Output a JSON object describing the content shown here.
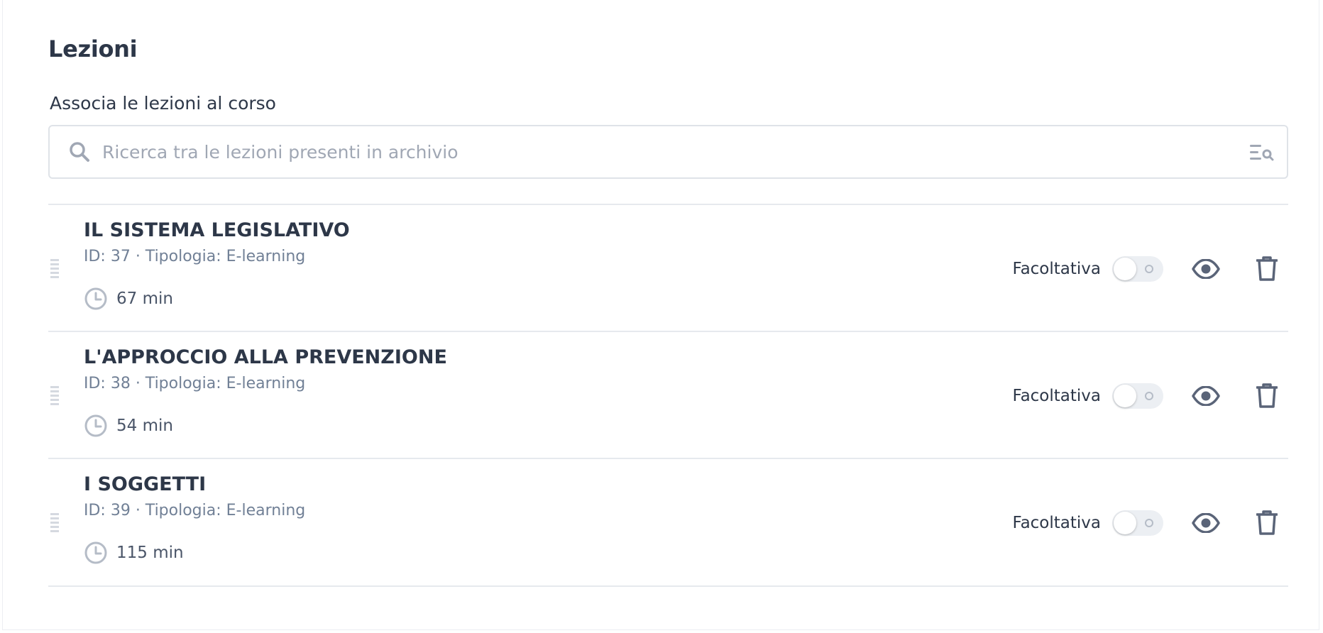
{
  "section": {
    "title": "Lezioni",
    "field_label": "Associa le lezioni al corso",
    "search_placeholder": "Ricerca tra le lezioni presenti in archivio"
  },
  "icons": {
    "search": "search-icon",
    "filter": "filter-search-icon",
    "drag": "drag-handle-icon",
    "clock": "clock-icon",
    "view": "eye-icon",
    "delete": "trash-icon"
  },
  "colors": {
    "text_primary": "#2d3748",
    "text_secondary": "#718096",
    "icon": "#5a6478",
    "toggle_off": "#eceff3",
    "divider": "#e6e9ee"
  },
  "lessons": [
    {
      "title": "IL SISTEMA LEGISLATIVO",
      "meta": "ID: 37 · Tipologia: E-learning",
      "duration": "67 min",
      "optional_label": "Facoltativa",
      "optional": false
    },
    {
      "title": "L'APPROCCIO ALLA PREVENZIONE",
      "meta": "ID: 38 · Tipologia: E-learning",
      "duration": "54 min",
      "optional_label": "Facoltativa",
      "optional": false
    },
    {
      "title": "I SOGGETTI",
      "meta": "ID: 39 · Tipologia: E-learning",
      "duration": "115 min",
      "optional_label": "Facoltativa",
      "optional": false
    }
  ]
}
